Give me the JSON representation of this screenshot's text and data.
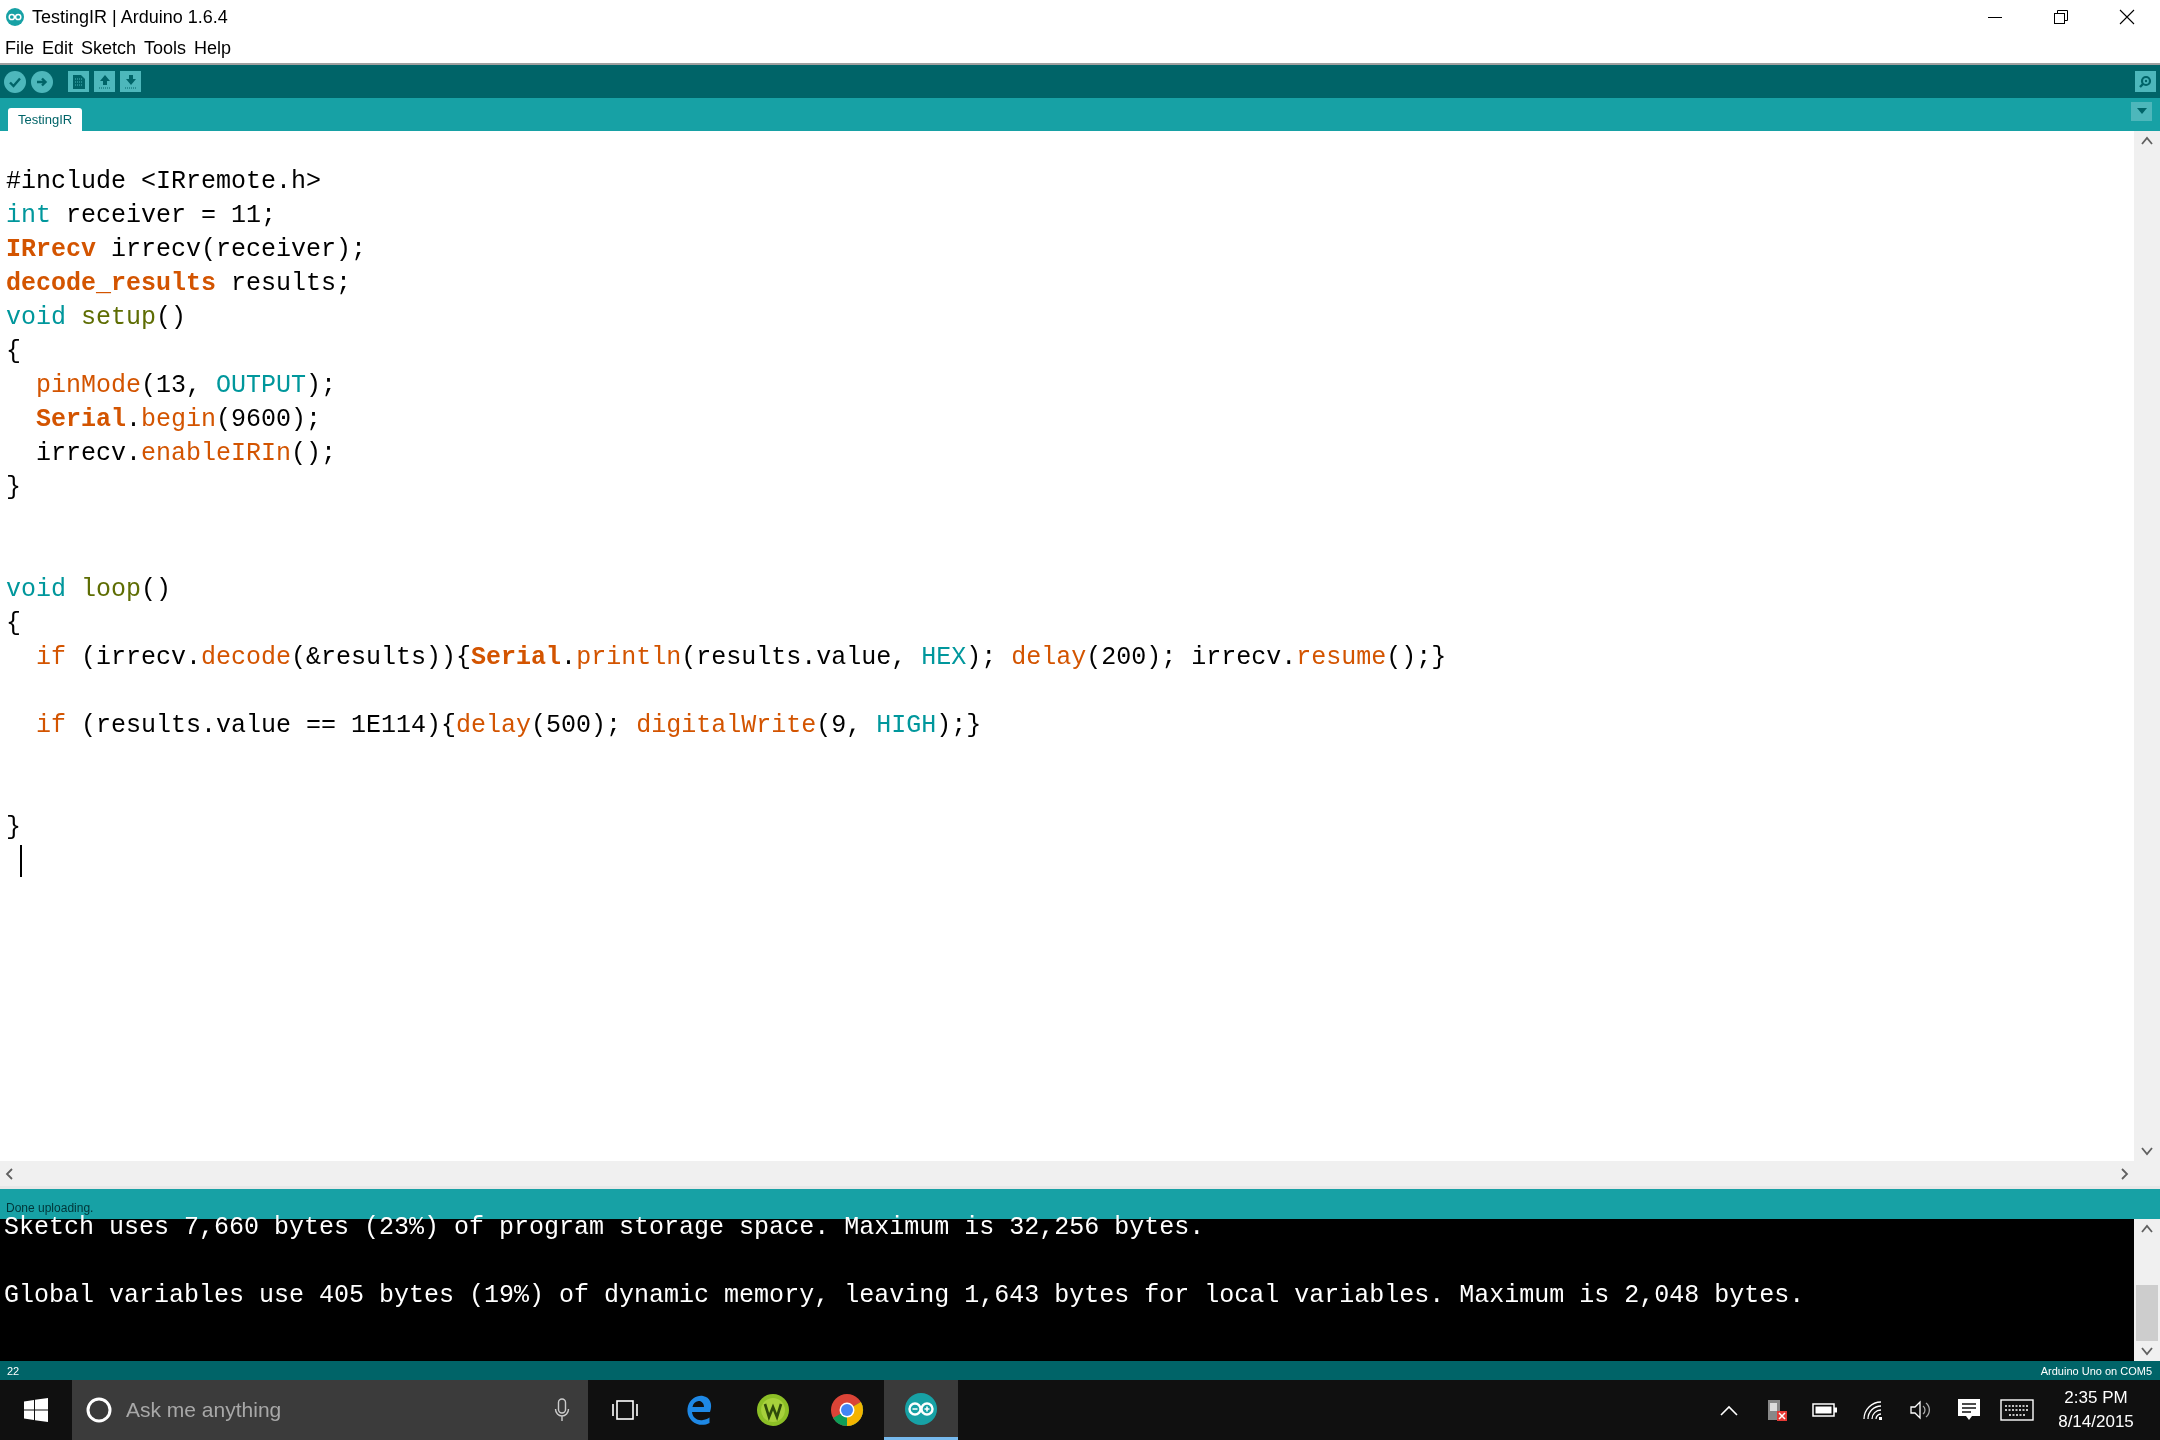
{
  "window": {
    "title": "TestingIR | Arduino 1.6.4"
  },
  "menu": [
    "File",
    "Edit",
    "Sketch",
    "Tools",
    "Help"
  ],
  "tabs": [
    {
      "label": "TestingIR",
      "selected": true
    }
  ],
  "editor": {
    "lines": [
      {
        "kind": "blank"
      },
      {
        "kind": "code",
        "tokens": [
          {
            "kind": "plain",
            "text": "#include <IRremote.h>"
          }
        ]
      },
      {
        "kind": "code",
        "tokens": [
          {
            "kind": "keyword",
            "text": "int"
          },
          {
            "kind": "plain",
            "text": " receiver = 11;"
          }
        ]
      },
      {
        "kind": "code",
        "tokens": [
          {
            "kind": "type",
            "text": "IRrecv"
          },
          {
            "kind": "plain",
            "text": " irrecv(receiver);"
          }
        ]
      },
      {
        "kind": "code",
        "tokens": [
          {
            "kind": "type",
            "text": "decode_results"
          },
          {
            "kind": "plain",
            "text": " results;"
          }
        ]
      },
      {
        "kind": "code",
        "tokens": [
          {
            "kind": "keyword",
            "text": "void "
          },
          {
            "kind": "name",
            "text": "setup"
          },
          {
            "kind": "plain",
            "text": "()"
          }
        ]
      },
      {
        "kind": "code",
        "tokens": [
          {
            "kind": "plain",
            "text": "{"
          }
        ]
      },
      {
        "kind": "code",
        "tokens": [
          {
            "kind": "function",
            "text": "  pinMode"
          },
          {
            "kind": "plain",
            "text": "(13, "
          },
          {
            "kind": "keyword",
            "text": "OUTPUT"
          },
          {
            "kind": "plain",
            "text": ");"
          }
        ]
      },
      {
        "kind": "code",
        "tokens": [
          {
            "kind": "type",
            "text": "  Serial"
          },
          {
            "kind": "plain",
            "text": "."
          },
          {
            "kind": "function",
            "text": "begin"
          },
          {
            "kind": "plain",
            "text": "(9600);"
          }
        ]
      },
      {
        "kind": "code",
        "tokens": [
          {
            "kind": "plain",
            "text": "  irrecv."
          },
          {
            "kind": "function",
            "text": "enableIRIn"
          },
          {
            "kind": "plain",
            "text": "();"
          }
        ]
      },
      {
        "kind": "code",
        "tokens": [
          {
            "kind": "plain",
            "text": "}"
          }
        ]
      },
      {
        "kind": "blank"
      },
      {
        "kind": "blank"
      },
      {
        "kind": "code",
        "tokens": [
          {
            "kind": "keyword",
            "text": "void "
          },
          {
            "kind": "name",
            "text": "loop"
          },
          {
            "kind": "plain",
            "text": "()"
          }
        ]
      },
      {
        "kind": "code",
        "tokens": [
          {
            "kind": "plain",
            "text": "{"
          }
        ]
      },
      {
        "kind": "code",
        "tokens": [
          {
            "kind": "function",
            "text": "  if"
          },
          {
            "kind": "plain",
            "text": " (irrecv."
          },
          {
            "kind": "function",
            "text": "decode"
          },
          {
            "kind": "plain",
            "text": "(&results)){"
          },
          {
            "kind": "type",
            "text": "Serial"
          },
          {
            "kind": "plain",
            "text": "."
          },
          {
            "kind": "function",
            "text": "println"
          },
          {
            "kind": "plain",
            "text": "(results.value, "
          },
          {
            "kind": "keyword",
            "text": "HEX"
          },
          {
            "kind": "plain",
            "text": "); "
          },
          {
            "kind": "function",
            "text": "delay"
          },
          {
            "kind": "plain",
            "text": "(200); irrecv."
          },
          {
            "kind": "function",
            "text": "resume"
          },
          {
            "kind": "plain",
            "text": "();}"
          }
        ]
      },
      {
        "kind": "blank"
      },
      {
        "kind": "code",
        "tokens": [
          {
            "kind": "function",
            "text": "  if"
          },
          {
            "kind": "plain",
            "text": " (results.value == 1E114){"
          },
          {
            "kind": "function",
            "text": "delay"
          },
          {
            "kind": "plain",
            "text": "(500); "
          },
          {
            "kind": "function",
            "text": "digitalWrite"
          },
          {
            "kind": "plain",
            "text": "(9, "
          },
          {
            "kind": "keyword",
            "text": "HIGH"
          },
          {
            "kind": "plain",
            "text": ");}"
          }
        ]
      },
      {
        "kind": "blank"
      },
      {
        "kind": "blank"
      },
      {
        "kind": "code",
        "tokens": [
          {
            "kind": "plain",
            "text": "}"
          }
        ]
      },
      {
        "kind": "caret"
      }
    ]
  },
  "status_message": "Done uploading.",
  "console": {
    "lines": [
      "Sketch uses 7,660 bytes (23%) of program storage space. Maximum is 32,256 bytes.",
      "Global variables use 405 bytes (19%) of dynamic memory, leaving 1,643 bytes for local variables. Maximum is 2,048 bytes."
    ]
  },
  "status_bar": {
    "line_number": "22",
    "board": "Arduino Uno on COM5"
  },
  "taskbar": {
    "search": {
      "placeholder": "Ask me anything"
    },
    "pinned": [
      {
        "selected": false
      },
      {
        "selected": false
      },
      {
        "selected": false
      },
      {
        "selected": false
      },
      {
        "selected": true
      }
    ],
    "clock": {
      "time": "2:35 PM",
      "date": "8/14/2015"
    }
  }
}
